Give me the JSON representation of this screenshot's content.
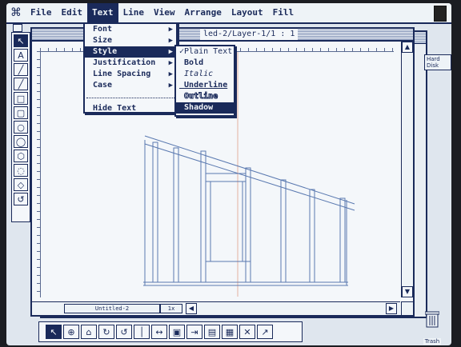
{
  "menubar": {
    "apple": "⌘",
    "items": [
      "File",
      "Edit",
      "Text",
      "Line",
      "View",
      "Arrange",
      "Layout",
      "Fill"
    ],
    "active_index": 2
  },
  "text_menu": {
    "items": [
      {
        "label": "Font",
        "submenu": true
      },
      {
        "label": "Size",
        "submenu": true
      },
      {
        "label": "Style",
        "submenu": true,
        "highlighted": true
      },
      {
        "label": "Justification",
        "submenu": true
      },
      {
        "label": "Line Spacing",
        "submenu": true
      },
      {
        "label": "Case",
        "submenu": true
      }
    ],
    "hide_text": "Hide Text",
    "arrow": "▶"
  },
  "style_submenu": {
    "items": [
      "Plain Text",
      "Bold",
      "Italic",
      "Underline",
      "Outline",
      "Shadow"
    ],
    "checked_index": 0,
    "check": "✓"
  },
  "document": {
    "title": "led-2/Layer-1/1 : 1",
    "page_name": "Untitled-2",
    "scale": "1x"
  },
  "desktop": {
    "disk_label": "Hard Disk",
    "trash_label": "Trash"
  },
  "tools": {
    "left": [
      "↖",
      "A",
      "╱",
      "╱",
      "□",
      "▢",
      "○",
      "◯",
      "⬡",
      "◌",
      "◇",
      "↺"
    ],
    "bottom": [
      "↖",
      "⊕",
      "⌂",
      "↻",
      "↺",
      "│",
      "↔",
      "▣",
      "⇥",
      "▤",
      "▦",
      "✕",
      "↗"
    ]
  }
}
